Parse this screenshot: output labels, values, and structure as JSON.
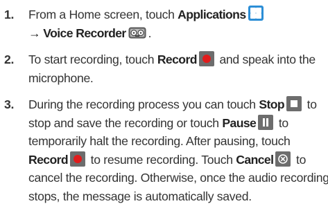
{
  "steps": [
    {
      "number": "1.",
      "lines": [
        {
          "t1": "From a Home screen, touch ",
          "k1": "Applications"
        },
        {
          "arrow": "→ ",
          "k1": "Voice Recorder",
          "t2": "."
        }
      ],
      "icons": [
        "applications-icon",
        "voice-recorder-icon"
      ]
    },
    {
      "number": "2.",
      "lines": [
        {
          "t1": "To start recording, touch ",
          "k1": "Record",
          "t2": " and speak into the"
        },
        {
          "t1": "microphone."
        }
      ],
      "icons": [
        "record-icon"
      ]
    },
    {
      "number": "3.",
      "lines": [
        {
          "t1": "During the recording process you can touch ",
          "k1": "Stop",
          "t2": " to"
        },
        {
          "t1": "stop and save the recording or touch ",
          "k1": "Pause",
          "t2": " to"
        },
        {
          "t1": "temporarily halt the recording. After pausing, touch"
        },
        {
          "k1": "Record",
          "t1": " to resume recording. Touch ",
          "k2": "Cancel",
          "t2": " to"
        },
        {
          "t1": "cancel the recording. Otherwise, once the audio recording"
        },
        {
          "t1": "stops, the message is automatically saved."
        }
      ],
      "icons": [
        "stop-icon",
        "pause-icon",
        "record-icon",
        "cancel-icon"
      ]
    }
  ],
  "colors": {
    "text": "#333333",
    "applications_icon": "#2c8ed6",
    "button_gray": "#6d6d6d",
    "record_red": "#e11c1c"
  }
}
